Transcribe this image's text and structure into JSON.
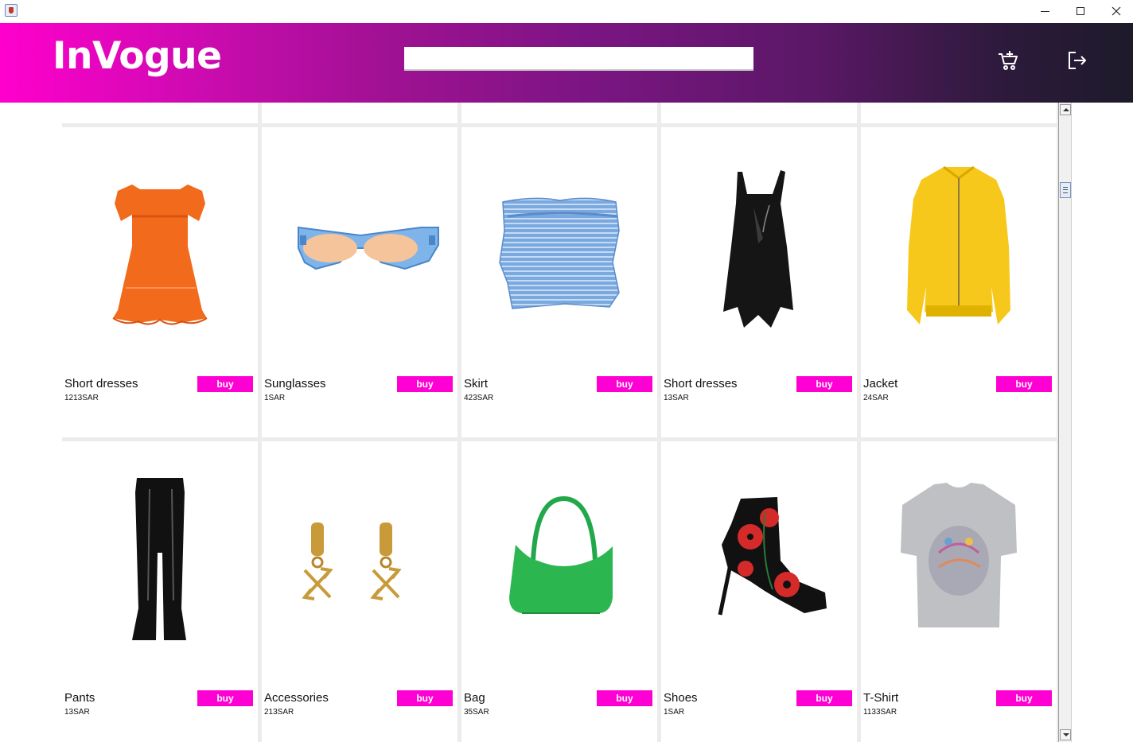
{
  "window": {
    "app_icon": "java-cup-icon",
    "minimize_icon": "minimize-icon",
    "maximize_icon": "maximize-icon",
    "close_icon": "close-icon"
  },
  "header": {
    "logo": "InVogue",
    "search_value": "",
    "cart_icon": "cart-add-icon",
    "logout_icon": "logout-icon",
    "gradient_start": "#ff00cc",
    "gradient_end": "#1d1a2a"
  },
  "buy_color": "#ff00d4",
  "products": [
    {
      "name": "Short dresses",
      "price": "1213SAR",
      "buy_label": "buy",
      "image": "orange-dress"
    },
    {
      "name": "Sunglasses",
      "price": "1SAR",
      "buy_label": "buy",
      "image": "blue-sunglasses"
    },
    {
      "name": "Skirt",
      "price": "423SAR",
      "buy_label": "buy",
      "image": "blue-striped-skirt"
    },
    {
      "name": "Short dresses",
      "price": "13SAR",
      "buy_label": "buy",
      "image": "black-dress"
    },
    {
      "name": "Jacket",
      "price": "24SAR",
      "buy_label": "buy",
      "image": "yellow-bomber-jacket"
    },
    {
      "name": "Pants",
      "price": "13SAR",
      "buy_label": "buy",
      "image": "black-flared-pants"
    },
    {
      "name": "Accessories",
      "price": "213SAR",
      "buy_label": "buy",
      "image": "gold-earrings"
    },
    {
      "name": "Bag",
      "price": "35SAR",
      "buy_label": "buy",
      "image": "green-hobo-bag"
    },
    {
      "name": "Shoes",
      "price": "1SAR",
      "buy_label": "buy",
      "image": "floral-lace-up-boot"
    },
    {
      "name": "T-Shirt",
      "price": "1133SAR",
      "buy_label": "buy",
      "image": "grey-graphic-tshirt"
    }
  ]
}
